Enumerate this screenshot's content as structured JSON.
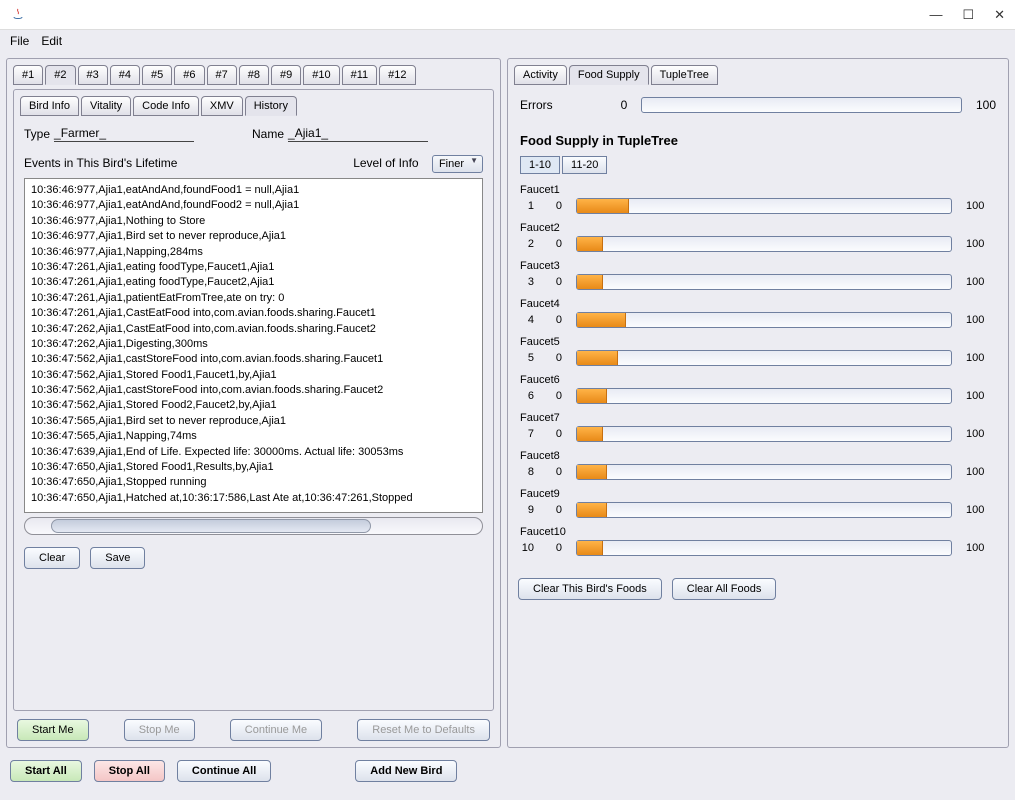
{
  "menus": {
    "file": "File",
    "edit": "Edit"
  },
  "win": {
    "min": "—",
    "max": "☐",
    "close": "✕"
  },
  "mainTabs": [
    "#1",
    "#2",
    "#3",
    "#4",
    "#5",
    "#6",
    "#7",
    "#8",
    "#9",
    "#10",
    "#11",
    "#12"
  ],
  "mainTabActive": 1,
  "subTabs": [
    "Bird Info",
    "Vitality",
    "Code Info",
    "XMV",
    "History"
  ],
  "subTabActive": 4,
  "typeLabel": "Type",
  "typeValue": "_Farmer_",
  "nameLabel": "Name",
  "nameValue": "_Ajia1_",
  "eventsHeader": "Events in This Bird's Lifetime",
  "levelLabel": "Level of Info",
  "levelValue": "Finer",
  "events": [
    "10:36:46:977,Ajia1,eatAndAnd,foundFood1 = null,Ajia1",
    "10:36:46:977,Ajia1,eatAndAnd,foundFood2 = null,Ajia1",
    "10:36:46:977,Ajia1,Nothing to Store",
    "10:36:46:977,Ajia1,Bird set to never reproduce,Ajia1",
    "10:36:46:977,Ajia1,Napping,284ms",
    "10:36:47:261,Ajia1,eating foodType,Faucet1,Ajia1",
    "10:36:47:261,Ajia1,eating foodType,Faucet2,Ajia1",
    "10:36:47:261,Ajia1,patientEatFromTree,ate on try: 0",
    "10:36:47:261,Ajia1,CastEatFood into,com.avian.foods.sharing.Faucet1",
    "10:36:47:262,Ajia1,CastEatFood into,com.avian.foods.sharing.Faucet2",
    "10:36:47:262,Ajia1,Digesting,300ms",
    "10:36:47:562,Ajia1,castStoreFood into,com.avian.foods.sharing.Faucet1",
    "10:36:47:562,Ajia1,Stored Food1,Faucet1,by,Ajia1",
    "10:36:47:562,Ajia1,castStoreFood into,com.avian.foods.sharing.Faucet2",
    "10:36:47:562,Ajia1,Stored Food2,Faucet2,by,Ajia1",
    "10:36:47:565,Ajia1,Bird set to never reproduce,Ajia1",
    "10:36:47:565,Ajia1,Napping,74ms",
    "10:36:47:639,Ajia1,End of Life. Expected life: 30000ms. Actual life: 30053ms",
    "10:36:47:650,Ajia1,Stored Food1,Results,by,Ajia1",
    "10:36:47:650,Ajia1,Stopped running",
    "10:36:47:650,Ajia1,Hatched at,10:36:17:586,Last Ate at,10:36:47:261,Stopped"
  ],
  "clearBtn": "Clear",
  "saveBtn": "Save",
  "startMe": "Start Me",
  "stopMe": "Stop Me",
  "continueMe": "Continue Me",
  "resetMe": "Reset Me to Defaults",
  "startAll": "Start All",
  "stopAll": "Stop All",
  "continueAll": "Continue All",
  "addNewBird": "Add New Bird",
  "rightTabs": [
    "Activity",
    "Food Supply",
    "TupleTree"
  ],
  "rightTabActive": 1,
  "errorsLabel": "Errors",
  "errorsLow": "0",
  "errorsHigh": "100",
  "sectionTitle": "Food Supply in TupleTree",
  "rangeTabs": [
    "1-10",
    "11-20"
  ],
  "rangeActive": 0,
  "faucetMax": "100",
  "faucets": [
    {
      "name": "Faucet1",
      "idx": "1",
      "low": "0",
      "pct": 14
    },
    {
      "name": "Faucet2",
      "idx": "2",
      "low": "0",
      "pct": 7
    },
    {
      "name": "Faucet3",
      "idx": "3",
      "low": "0",
      "pct": 7
    },
    {
      "name": "Faucet4",
      "idx": "4",
      "low": "0",
      "pct": 13
    },
    {
      "name": "Faucet5",
      "idx": "5",
      "low": "0",
      "pct": 11
    },
    {
      "name": "Faucet6",
      "idx": "6",
      "low": "0",
      "pct": 8
    },
    {
      "name": "Faucet7",
      "idx": "7",
      "low": "0",
      "pct": 7
    },
    {
      "name": "Faucet8",
      "idx": "8",
      "low": "0",
      "pct": 8
    },
    {
      "name": "Faucet9",
      "idx": "9",
      "low": "0",
      "pct": 8
    },
    {
      "name": "Faucet10",
      "idx": "10",
      "low": "0",
      "pct": 7
    }
  ],
  "clearThis": "Clear This Bird's Foods",
  "clearAll": "Clear All Foods"
}
